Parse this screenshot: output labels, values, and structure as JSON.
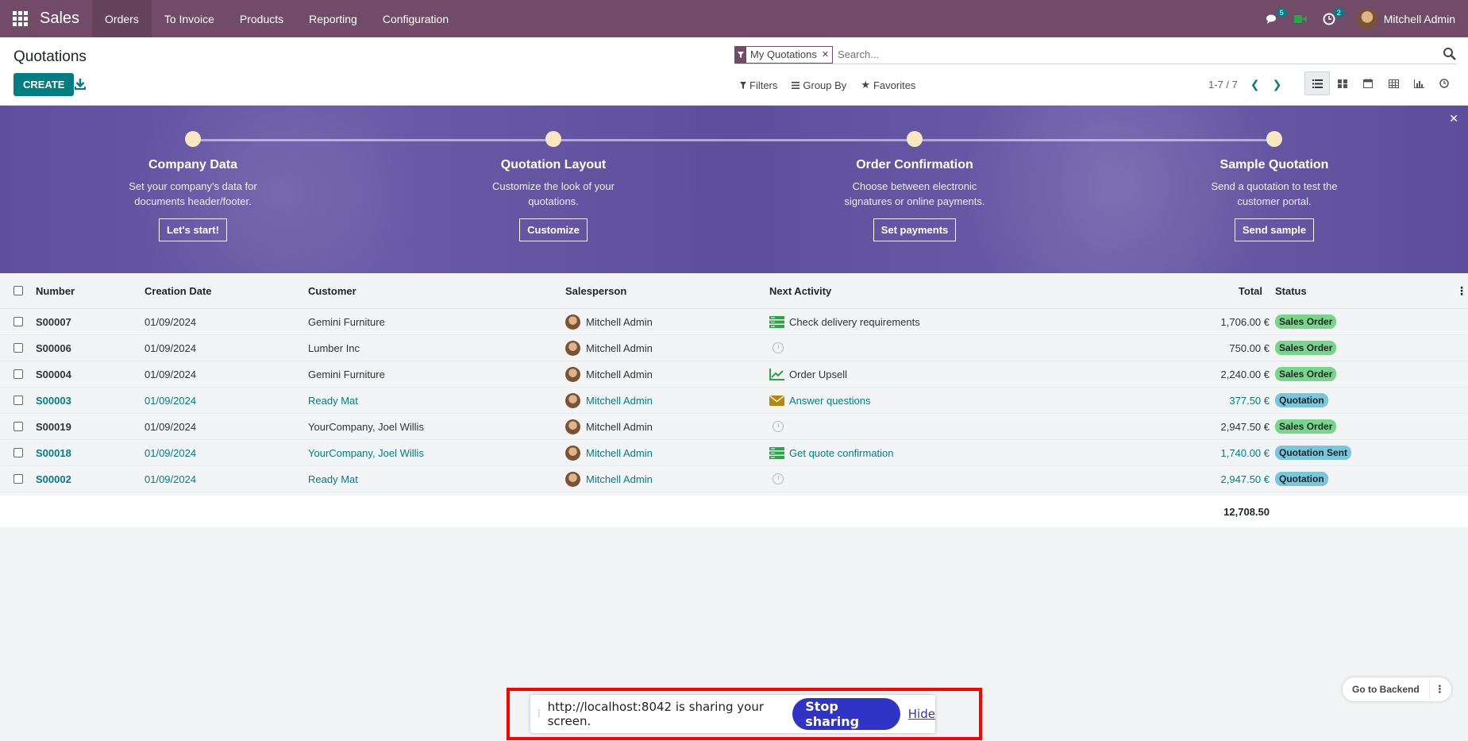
{
  "navbar": {
    "app_name": "Sales",
    "menu": [
      "Orders",
      "To Invoice",
      "Products",
      "Reporting",
      "Configuration"
    ],
    "chat_count": "5",
    "activity_count": "2",
    "user_name": "Mitchell Admin"
  },
  "control_panel": {
    "title": "Quotations",
    "create_label": "CREATE",
    "facet_label": "My Quotations",
    "search_placeholder": "Search...",
    "filters_label": "Filters",
    "groupby_label": "Group By",
    "favorites_label": "Favorites",
    "pager_text": "1-7 / 7"
  },
  "onboarding": {
    "steps": [
      {
        "title": "Company Data",
        "desc": "Set your company's data for documents header/footer.",
        "button": "Let's start!"
      },
      {
        "title": "Quotation Layout",
        "desc": "Customize the look of your quotations.",
        "button": "Customize"
      },
      {
        "title": "Order Confirmation",
        "desc": "Choose between electronic signatures or online payments.",
        "button": "Set payments"
      },
      {
        "title": "Sample Quotation",
        "desc": "Send a quotation to test the customer portal.",
        "button": "Send sample"
      }
    ]
  },
  "table": {
    "headers": {
      "number": "Number",
      "date": "Creation Date",
      "customer": "Customer",
      "salesperson": "Salesperson",
      "activity": "Next Activity",
      "total": "Total",
      "status": "Status"
    },
    "rows": [
      {
        "number": "S00007",
        "date": "01/09/2024",
        "customer": "Gemini Furniture",
        "salesperson": "Mitchell Admin",
        "activity": "Check delivery requirements",
        "activity_icon": "todo-list-icon",
        "total": "1,706.00 €",
        "status": "Sales Order",
        "link": false
      },
      {
        "number": "S00006",
        "date": "01/09/2024",
        "customer": "Lumber Inc",
        "salesperson": "Mitchell Admin",
        "activity": "",
        "activity_icon": "clock-icon",
        "total": "750.00 €",
        "status": "Sales Order",
        "link": false
      },
      {
        "number": "S00004",
        "date": "01/09/2024",
        "customer": "Gemini Furniture",
        "salesperson": "Mitchell Admin",
        "activity": "Order Upsell",
        "activity_icon": "upsell-chart-icon",
        "total": "2,240.00 €",
        "status": "Sales Order",
        "link": false
      },
      {
        "number": "S00003",
        "date": "01/09/2024",
        "customer": "Ready Mat",
        "salesperson": "Mitchell Admin",
        "activity": "Answer questions",
        "activity_icon": "envelope-icon",
        "total": "377.50 €",
        "status": "Quotation",
        "link": true
      },
      {
        "number": "S00019",
        "date": "01/09/2024",
        "customer": "YourCompany, Joel Willis",
        "salesperson": "Mitchell Admin",
        "activity": "",
        "activity_icon": "clock-icon",
        "total": "2,947.50 €",
        "status": "Sales Order",
        "link": false
      },
      {
        "number": "S00018",
        "date": "01/09/2024",
        "customer": "YourCompany, Joel Willis",
        "salesperson": "Mitchell Admin",
        "activity": "Get quote confirmation",
        "activity_icon": "todo-list-icon",
        "total": "1,740.00 €",
        "status": "Quotation Sent",
        "link": true
      },
      {
        "number": "S00002",
        "date": "01/09/2024",
        "customer": "Ready Mat",
        "salesperson": "Mitchell Admin",
        "activity": "",
        "activity_icon": "clock-icon",
        "total": "2,947.50 €",
        "status": "Quotation",
        "link": true
      }
    ],
    "grand_total": "12,708.50"
  },
  "screen_share": {
    "message": "http://localhost:8042 is sharing your screen.",
    "stop_label": "Stop sharing",
    "hide_label": "Hide"
  },
  "backend": {
    "label": "Go to Backend"
  },
  "colors": {
    "brand": "#714b67",
    "accent": "#017e84",
    "sales_order_badge": "#7ad58c",
    "quotation_badge": "#79c7dc",
    "stop_sharing": "#2f33c6"
  }
}
